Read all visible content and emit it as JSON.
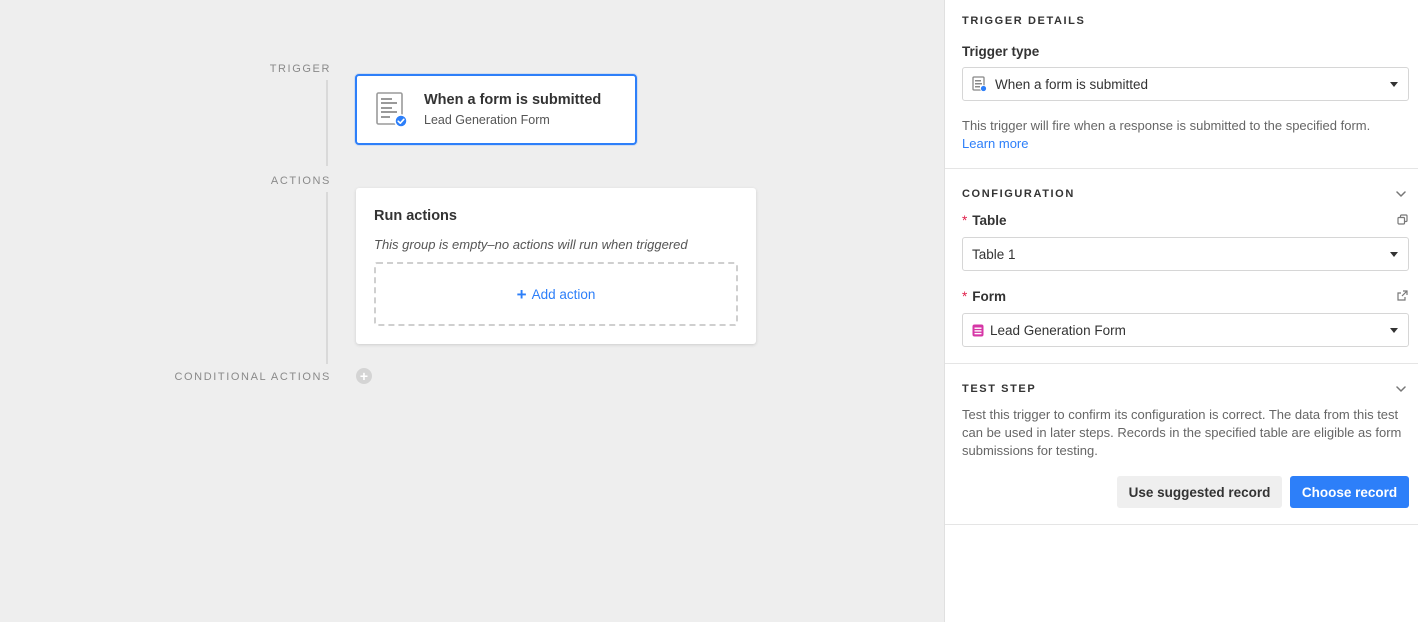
{
  "canvas": {
    "trigger_label": "TRIGGER",
    "actions_label": "ACTIONS",
    "conditional_actions_label": "CONDITIONAL ACTIONS",
    "trigger_card": {
      "title": "When a form is submitted",
      "subtitle": "Lead Generation Form",
      "icon": "form-submitted-icon"
    },
    "actions_card": {
      "title": "Run actions",
      "empty_text": "This group is empty–no actions will run when triggered",
      "add_action_label": "Add action",
      "add_action_icon": "plus-icon"
    },
    "conditional_add_icon": "plus-circle-icon"
  },
  "panel": {
    "trigger_details": {
      "heading": "TRIGGER DETAILS",
      "trigger_type_label": "Trigger type",
      "trigger_type_value": "When a form is submitted",
      "description": "This trigger will fire when a response is submitted to the specified form.",
      "learn_more": "Learn more"
    },
    "configuration": {
      "heading": "CONFIGURATION",
      "table_label": "Table",
      "table_value": "Table 1",
      "form_label": "Form",
      "form_value": "Lead Generation Form",
      "required_marker": "*"
    },
    "test_step": {
      "heading": "TEST STEP",
      "description": "Test this trigger to confirm its configuration is correct. The data from this test can be used in later steps. Records in the specified table are eligible as form submissions for testing.",
      "use_suggested_label": "Use suggested record",
      "choose_record_label": "Choose record"
    }
  },
  "colors": {
    "accent": "#2d7ff9",
    "required": "#e0204b",
    "form_icon": "#d636a6",
    "canvas_bg": "#eeeeee"
  }
}
